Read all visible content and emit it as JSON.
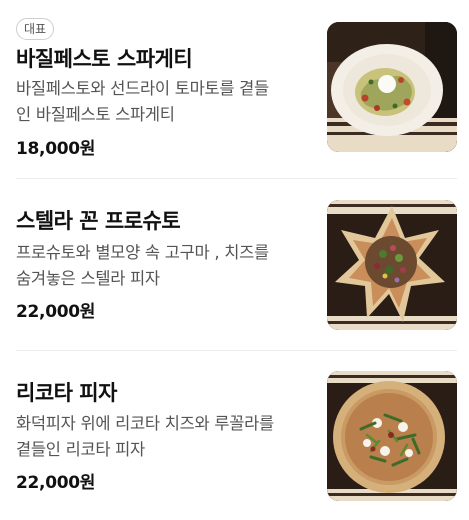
{
  "menu": {
    "items": [
      {
        "badge": "대표",
        "name": "바질페스토 스파게티",
        "desc_line1": "바질페스토와 선드라이 토마토를 곁들",
        "desc_line2": "인 바질페스토 스파게티",
        "price": "18,000원",
        "image": "basil-pesto-spaghetti-photo"
      },
      {
        "name": "스텔라 꼰 프로슈토",
        "desc_line1": "프로슈토와 별모양 속 고구마 , 치즈를",
        "desc_line2": "숨겨놓은 스텔라 피자",
        "price": "22,000원",
        "image": "stella-pizza-photo"
      },
      {
        "name": "리코타 피자",
        "desc_line1": "화덕피자 위에 리코타 치즈와 루꼴라를",
        "desc_line2": "곁들인 리코타 피자",
        "price": "22,000원",
        "image": "ricotta-pizza-photo"
      }
    ]
  }
}
